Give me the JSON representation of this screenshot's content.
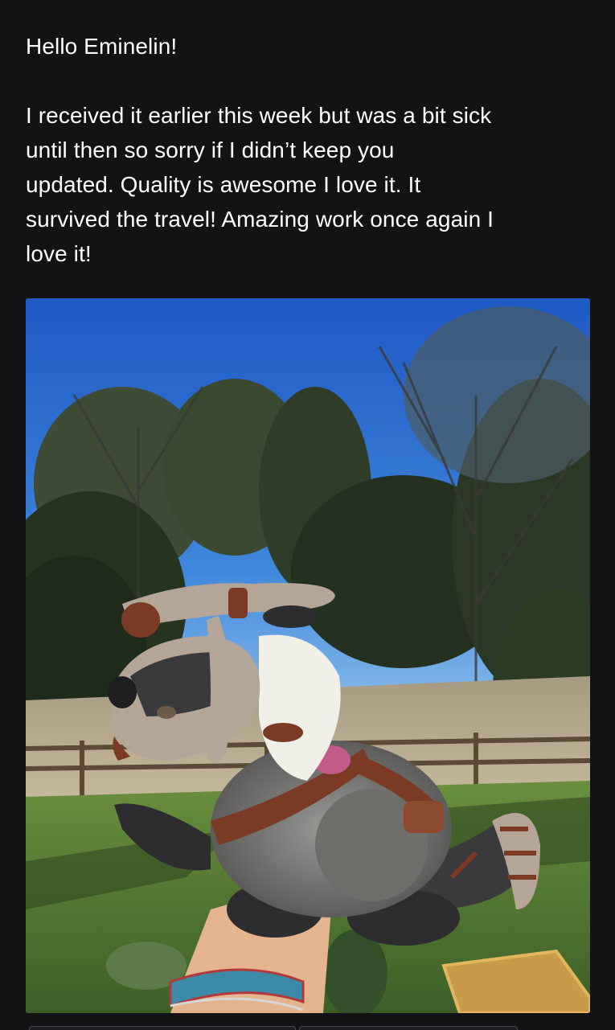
{
  "message": {
    "greeting": "Hello Eminelin!",
    "lines": [
      "I received it earlier this week but was a bit sick",
      "until then so sorry if I didn’t keep you",
      "updated. Quality is awesome I love it. It",
      "survived the travel! Amazing work once again I",
      "love it!"
    ]
  },
  "photo": {
    "subject": "crochet creature held in hand outdoors",
    "colors": {
      "sky": "#2f6cd1",
      "sky_light": "#8fc2ee",
      "trees": "#2d3a24",
      "grass": "#4f7a35",
      "yarn_grey": "#8c8b88",
      "yarn_dark": "#3a3a3c",
      "yarn_beige": "#b5a597",
      "yarn_brown": "#7a3a26",
      "yarn_white": "#f0efe8",
      "yarn_pink": "#c25a8a"
    }
  }
}
